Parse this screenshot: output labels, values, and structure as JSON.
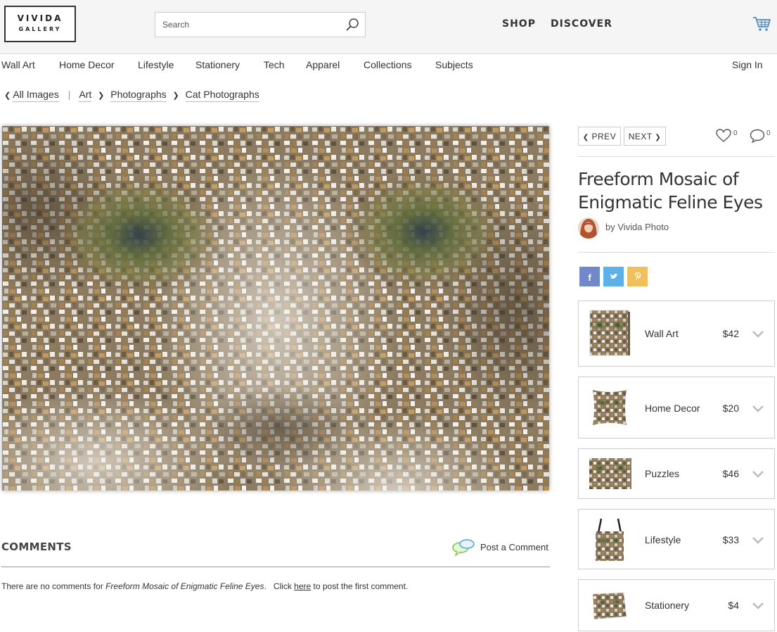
{
  "header": {
    "logo_line1": "VIVIDA",
    "logo_line2": "GALLERY",
    "search_placeholder": "Search",
    "nav_shop": "SHOP",
    "nav_discover": "DISCOVER"
  },
  "categories": [
    "Wall Art",
    "Home Decor",
    "Lifestyle",
    "Stationery",
    "Tech",
    "Apparel",
    "Collections",
    "Subjects"
  ],
  "sign_in": "Sign In",
  "breadcrumb": {
    "all_images": "All Images",
    "separator": "|",
    "items": [
      "Art",
      "Photographs",
      "Cat Photographs"
    ]
  },
  "comments": {
    "title": "COMMENTS",
    "post_label": "Post a Comment",
    "empty_prefix": "There are no comments for ",
    "empty_title": "Freeform Mosaic of Enigmatic Feline Eyes",
    "empty_mid": ".   Click ",
    "empty_link": "here",
    "empty_suffix": " to post the first comment."
  },
  "artwork_nav": {
    "prev": "PREV",
    "next": "NEXT",
    "likes": "0",
    "comments_count": "0"
  },
  "artwork": {
    "title": "Freeform Mosaic of Enigmatic Feline Eyes",
    "artist": "by Vivida Photo"
  },
  "share": {
    "facebook": "f",
    "facebook_color": "#7189c9",
    "twitter_color": "#5eb1e8",
    "pinterest_color": "#f0c05c"
  },
  "products": [
    {
      "name": "Wall Art",
      "price": "$42",
      "thumb_icon": "canvas-print-icon"
    },
    {
      "name": "Home Decor",
      "price": "$20",
      "thumb_icon": "pillow-icon"
    },
    {
      "name": "Puzzles",
      "price": "$46",
      "thumb_icon": "puzzle-icon"
    },
    {
      "name": "Lifestyle",
      "price": "$33",
      "thumb_icon": "tote-bag-icon"
    },
    {
      "name": "Stationery",
      "price": "$4",
      "thumb_icon": "greeting-card-icon"
    }
  ]
}
